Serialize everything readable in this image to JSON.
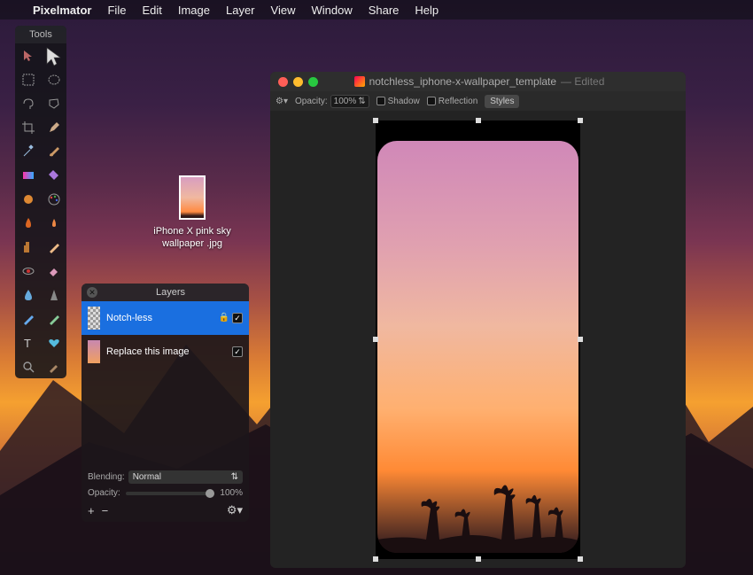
{
  "menubar": {
    "app_name": "Pixelmator",
    "items": [
      "File",
      "Edit",
      "Image",
      "Layer",
      "View",
      "Window",
      "Share",
      "Help"
    ]
  },
  "tools_panel": {
    "title": "Tools"
  },
  "desktop_file": {
    "name_line1": "iPhone X pink sky",
    "name_line2": "wallpaper .jpg"
  },
  "layers_panel": {
    "title": "Layers",
    "layers": [
      {
        "name": "Notch-less",
        "locked": true,
        "selected": true
      },
      {
        "name": "Replace this image",
        "locked": false,
        "selected": false
      }
    ],
    "blending_label": "Blending:",
    "blending_value": "Normal",
    "opacity_label": "Opacity:",
    "opacity_value": "100%"
  },
  "document": {
    "title": "notchless_iphone-x-wallpaper_template",
    "edited_suffix": "— Edited",
    "toolbar": {
      "opacity_label": "Opacity:",
      "opacity_value": "100%",
      "shadow_label": "Shadow",
      "reflection_label": "Reflection",
      "styles_label": "Styles"
    }
  }
}
